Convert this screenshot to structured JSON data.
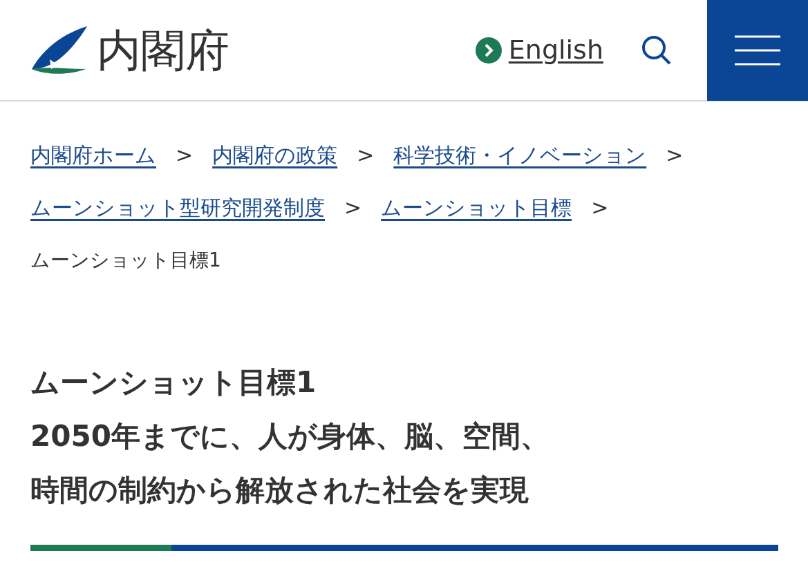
{
  "header": {
    "site_name": "内閣府",
    "language_link": "English"
  },
  "breadcrumbs": {
    "separator": ">",
    "items": [
      {
        "label": "内閣府ホーム",
        "kind": "link"
      },
      {
        "label": "内閣府の政策",
        "kind": "link"
      },
      {
        "label": "科学技術・イノベーション",
        "kind": "link"
      },
      {
        "label": "ムーンショット型研究開発制度",
        "kind": "link"
      },
      {
        "label": "ムーンショット目標",
        "kind": "link"
      },
      {
        "label": "ムーンショット目標1",
        "kind": "current"
      }
    ]
  },
  "title": {
    "lines": [
      "ムーンショット目標1",
      "2050年までに、人が身体、脳、空間、",
      "時間の制約から解放された社会を実現"
    ]
  }
}
